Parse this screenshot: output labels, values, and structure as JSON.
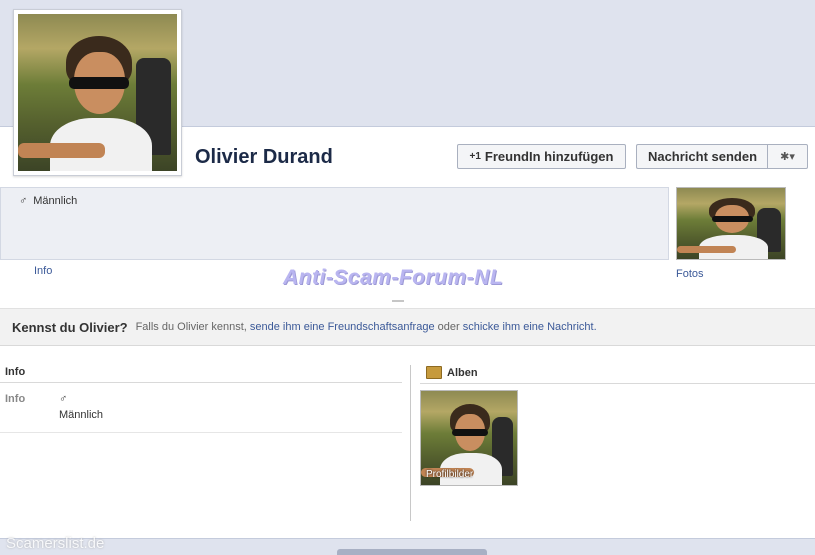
{
  "profile": {
    "name": "Olivier Durand",
    "gender_icon": "♂",
    "gender": "Männlich"
  },
  "actions": {
    "add_friend_icon": "+1",
    "add_friend_label": "FreundIn hinzufügen",
    "message_label": "Nachricht senden",
    "settings_icon": "✱▾"
  },
  "tabs": {
    "info": "Info",
    "fotos": "Fotos"
  },
  "watermark": "Anti-Scam-Forum-NL",
  "kennst": {
    "title": "Kennst du Olivier?",
    "text_prefix": "Falls du Olivier kennst,",
    "link_request": "sende ihm eine Freundschaftsanfrage",
    "text_or": "oder",
    "link_message": "schicke ihm eine Nachricht."
  },
  "info_section": {
    "header": "Info",
    "key": "Info",
    "gender_icon": "♂",
    "value": "Männlich"
  },
  "alben": {
    "header": "Alben",
    "album_label": "Profilbilder"
  },
  "footer_watermark": "Scamerslist.de"
}
